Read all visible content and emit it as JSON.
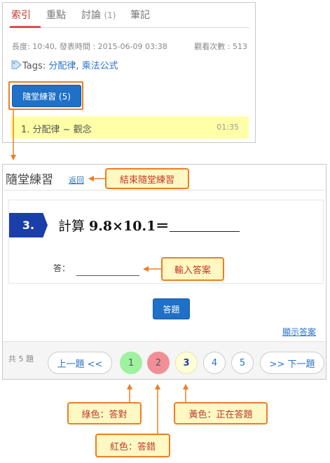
{
  "tabs": [
    {
      "label": "索引",
      "count": ""
    },
    {
      "label": "重點",
      "count": ""
    },
    {
      "label": "討論",
      "count": "(1)"
    },
    {
      "label": "筆記",
      "count": ""
    }
  ],
  "meta": {
    "info": "長度: 10:40, 發表時間 : 2015-06-09 03:38",
    "views": "觀看次數 : 513"
  },
  "tags": {
    "prefix": "Tags:",
    "items": [
      "分配律",
      "乘法公式"
    ],
    "separator": ", "
  },
  "practice_button": "隨堂練習 (5)",
  "chapter": {
    "label": "1. 分配律 ~ 觀念",
    "time": "01:35"
  },
  "quiz": {
    "title": "隨堂練習",
    "back": "返回",
    "question_number": "3.",
    "question_prefix": "計算 ",
    "question_expr": "9.8×10.1＝",
    "answer_label": "答：",
    "answer_value": "",
    "submit": "答題",
    "show_answer": "顯示答案"
  },
  "pager": {
    "total": "共 5 題",
    "prev": "上一題 <<",
    "next": ">> 下一題",
    "pages": [
      {
        "label": "1",
        "state": "correct"
      },
      {
        "label": "2",
        "state": "wrong"
      },
      {
        "label": "3",
        "state": "current"
      },
      {
        "label": "4",
        "state": "unanswered"
      },
      {
        "label": "5",
        "state": "unanswered"
      }
    ]
  },
  "callouts": {
    "end_practice": "結束隨堂練習",
    "input_answer": "輸入答案",
    "green": "綠色：答對",
    "red": "紅色：答錯",
    "yellow": "黃色：正在答題"
  },
  "colors": {
    "accent_orange": "#ee7d25",
    "brand_blue": "#1f70c7",
    "active_tab": "#c0392b",
    "correct_green": "#9ef29e",
    "wrong_red": "#f28f96",
    "current_yellow": "#ffffd6",
    "highlight_yellow": "#ffffa8"
  }
}
